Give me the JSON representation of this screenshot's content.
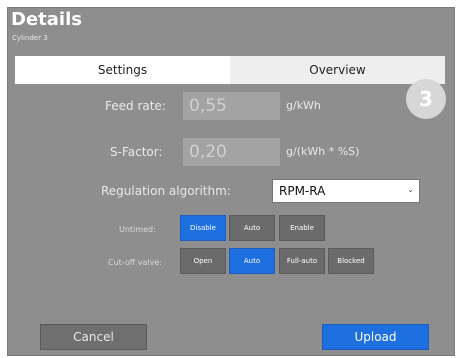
{
  "dialog": {
    "title": "Details",
    "subtitle": "Cylinder 3",
    "badge_number": "3"
  },
  "tabs": [
    {
      "label": "Settings",
      "active": true
    },
    {
      "label": "Overview",
      "active": false
    }
  ],
  "fields": {
    "feed_rate": {
      "label": "Feed rate:",
      "value": "0,55",
      "unit": "g/kWh"
    },
    "s_factor": {
      "label": "S-Factor:",
      "value": "0,20",
      "unit": "g/(kWh * %S)"
    },
    "regulation": {
      "label": "Regulation algorithm:",
      "selected": "RPM-RA"
    }
  },
  "untimed": {
    "label": "Untimed:",
    "options": [
      "Disable",
      "Auto",
      "Enable"
    ],
    "selected": "Disable"
  },
  "cutoff": {
    "label": "Cut-off valve:",
    "options": [
      "Open",
      "Auto",
      "Full-auto",
      "Blocked"
    ],
    "selected": "Auto"
  },
  "actions": {
    "cancel_label": "Cancel",
    "upload_label": "Upload"
  },
  "colors": {
    "accent": "#1e6fe0",
    "panel": "#8e8e8e",
    "button_dark": "#6b6b6b"
  }
}
